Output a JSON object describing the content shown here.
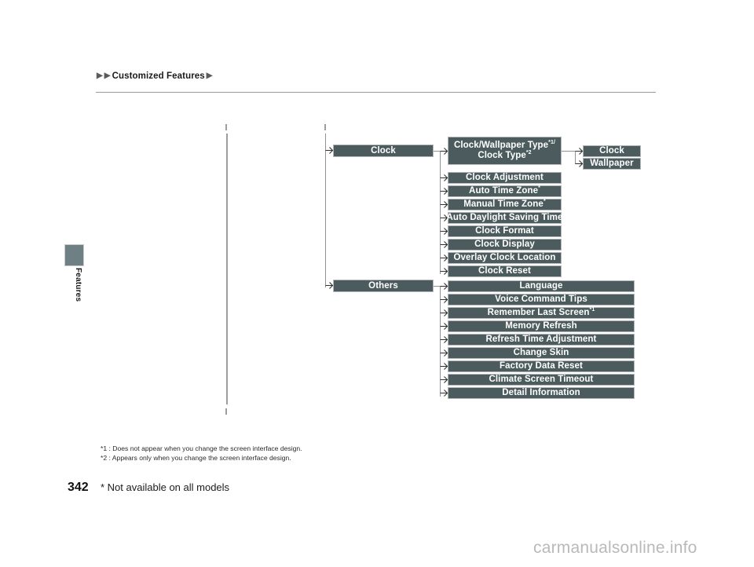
{
  "header": {
    "breadcrumb_arrow": "▶",
    "breadcrumb_text": "Customized Features"
  },
  "side_tab": {
    "label": "Features"
  },
  "diagram": {
    "branches": [
      {
        "name": "clock",
        "parent": "Clock",
        "children": [
          {
            "label": "Clock/Wallpaper Type",
            "sup": "*1/",
            "label2": "Clock Type",
            "sup2": "*2",
            "two_line": true
          },
          {
            "label": "Clock Adjustment"
          },
          {
            "label": "Auto Time Zone",
            "sup": "*"
          },
          {
            "label": "Manual Time Zone",
            "sup": "*"
          },
          {
            "label": "Auto Daylight Saving Time"
          },
          {
            "label": "Clock Format"
          },
          {
            "label": "Clock Display"
          },
          {
            "label": "Overlay Clock Location"
          },
          {
            "label": "Clock Reset"
          }
        ],
        "grandchildren": [
          {
            "label": "Clock"
          },
          {
            "label": "Wallpaper"
          }
        ]
      },
      {
        "name": "others",
        "parent": "Others",
        "children": [
          {
            "label": "Language"
          },
          {
            "label": "Voice Command Tips"
          },
          {
            "label": "Remember Last Screen",
            "sup": "*1"
          },
          {
            "label": "Memory Refresh"
          },
          {
            "label": "Refresh Time Adjustment"
          },
          {
            "label": "Change Skin"
          },
          {
            "label": "Factory Data Reset"
          },
          {
            "label": "Climate Screen Timeout"
          },
          {
            "label": "Detail Information"
          }
        ]
      }
    ]
  },
  "footnotes": [
    "*1 : Does not appear when you change the screen interface design.",
    "*2 : Appears only when you change the screen interface design."
  ],
  "page": {
    "number": "342",
    "note": "* Not available on all models"
  },
  "watermark": "carmanualsonline.info",
  "colors": {
    "node_fill": "#4c5c5e",
    "node_border": "#b4b8ba",
    "tab_fill": "#6e8083",
    "connector": "#8f9294",
    "rule": "#9a9a9a",
    "watermark": "#b9b9b9"
  }
}
